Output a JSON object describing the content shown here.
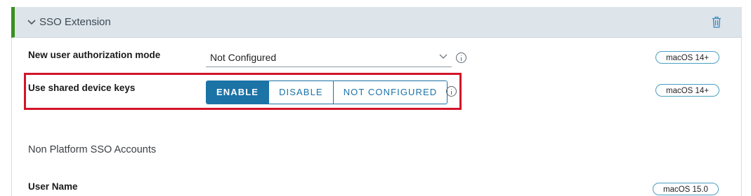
{
  "section": {
    "title": "SSO Extension"
  },
  "settings": {
    "auth_mode": {
      "label": "New user authorization mode",
      "value": "Not Configured",
      "badge": "macOS 14+"
    },
    "shared_keys": {
      "label": "Use shared device keys",
      "options": [
        "ENABLE",
        "DISABLE",
        "NOT CONFIGURED"
      ],
      "selected": "ENABLE",
      "badge": "macOS 14+"
    }
  },
  "non_platform": {
    "heading": "Non Platform SSO Accounts",
    "user_name_label": "User Name",
    "badge": "macOS 15.0"
  },
  "colors": {
    "accent": "#1b73a6",
    "section_stripe": "#3a8f1e",
    "highlight_box": "#d2142a",
    "badge_border": "#4a9fc2"
  },
  "icons": [
    "chevron-down-icon",
    "trash-icon",
    "caret-down-icon",
    "info-icon"
  ]
}
